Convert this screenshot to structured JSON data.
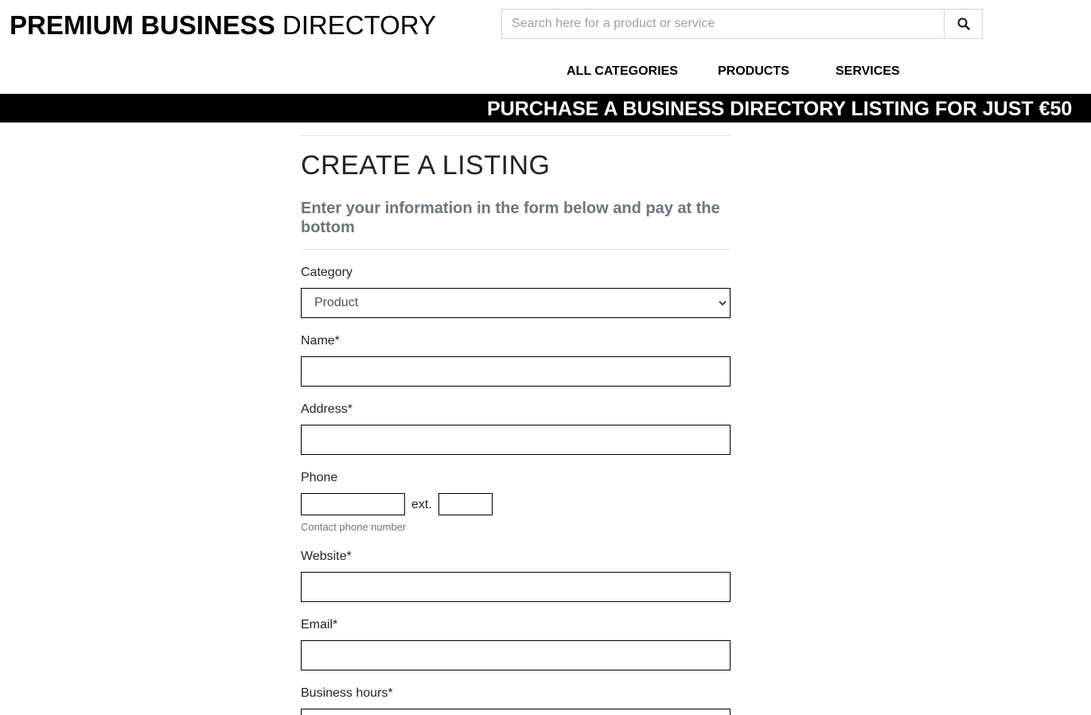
{
  "header": {
    "logo_bold": "PREMIUM BUSINESS",
    "logo_light": "DIRECTORY",
    "search_placeholder": "Search here for a product or service"
  },
  "nav": {
    "items": [
      {
        "label": "ALL CATEGORIES"
      },
      {
        "label": "PRODUCTS"
      },
      {
        "label": "SERVICES"
      }
    ]
  },
  "banner": {
    "text": "PURCHASE A BUSINESS DIRECTORY LISTING FOR JUST €50"
  },
  "form": {
    "title": "CREATE A LISTING",
    "subtitle": "Enter your information in the form below and pay at the bottom",
    "category_label": "Category",
    "category_value": "Product",
    "name_label": "Name*",
    "name_value": "",
    "address_label": "Address*",
    "address_value": "",
    "phone_label": "Phone",
    "phone_value": "",
    "ext_label": "ext.",
    "ext_value": "",
    "phone_hint": "Contact phone number",
    "website_label": "Website*",
    "website_value": "",
    "email_label": "Email*",
    "email_value": "",
    "hours_label": "Business hours*"
  },
  "icons": {
    "search": "search-icon",
    "dropdown": "chevron-down-icon"
  },
  "colors": {
    "banner_bg": "#000000",
    "banner_text": "#ffffff",
    "muted": "#6c757d"
  }
}
